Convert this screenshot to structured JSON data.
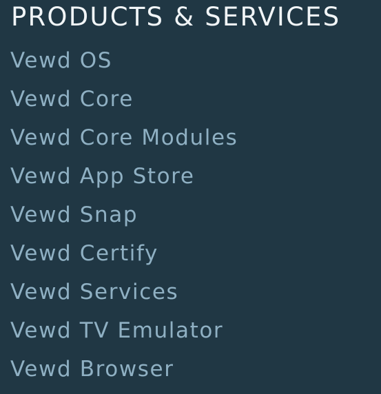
{
  "section": {
    "heading": "PRODUCTS & SERVICES",
    "links": [
      {
        "label": "Vewd OS"
      },
      {
        "label": "Vewd Core"
      },
      {
        "label": "Vewd Core Modules"
      },
      {
        "label": "Vewd App Store"
      },
      {
        "label": "Vewd Snap"
      },
      {
        "label": "Vewd Certify"
      },
      {
        "label": "Vewd Services"
      },
      {
        "label": "Vewd TV Emulator"
      },
      {
        "label": "Vewd Browser"
      }
    ]
  },
  "colors": {
    "background": "#203744",
    "heading": "#f1f5f7",
    "link": "#8fb0c3"
  }
}
